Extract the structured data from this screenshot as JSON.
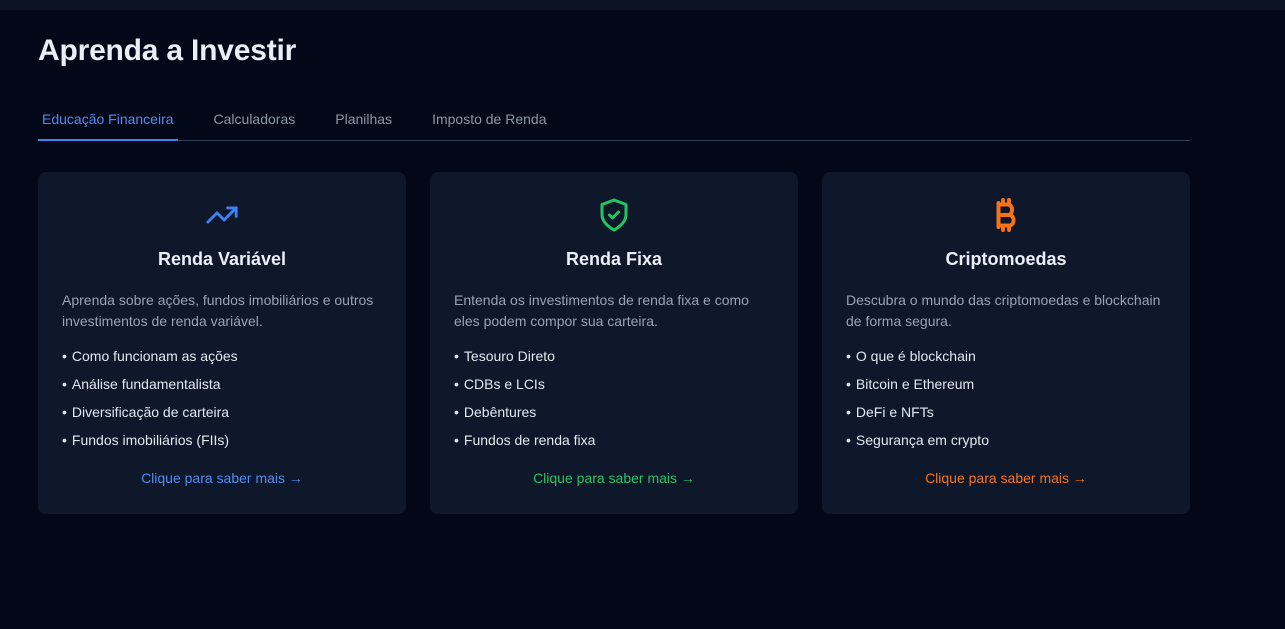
{
  "page": {
    "title": "Aprenda a Investir"
  },
  "tabs": [
    {
      "label": "Educação Financeira",
      "active": true
    },
    {
      "label": "Calculadoras",
      "active": false
    },
    {
      "label": "Planilhas",
      "active": false
    },
    {
      "label": "Imposto de Renda",
      "active": false
    }
  ],
  "cards": [
    {
      "icon": "trending-up-icon",
      "accent": "#3b82f6",
      "title": "Renda Variável",
      "description": "Aprenda sobre ações, fundos imobiliários e outros investimentos de renda variável.",
      "bullet": "•",
      "items": [
        "Como funcionam as ações",
        "Análise fundamentalista",
        "Diversificação de carteira",
        "Fundos imobiliários (FIIs)"
      ],
      "link": "Clique para saber mais →"
    },
    {
      "icon": "shield-check-icon",
      "accent": "#22c55e",
      "title": "Renda Fixa",
      "description": "Entenda os investimentos de renda fixa e como eles podem compor sua carteira.",
      "bullet": "•",
      "items": [
        "Tesouro Direto",
        "CDBs e LCIs",
        "Debêntures",
        "Fundos de renda fixa"
      ],
      "link": "Clique para saber mais →"
    },
    {
      "icon": "bitcoin-icon",
      "accent": "#f97316",
      "title": "Criptomoedas",
      "description": "Descubra o mundo das criptomoedas e blockchain de forma segura.",
      "bullet": "•",
      "items": [
        "O que é blockchain",
        "Bitcoin e Ethereum",
        "DeFi e NFTs",
        "Segurança em crypto"
      ],
      "link": "Clique para saber mais →"
    }
  ]
}
